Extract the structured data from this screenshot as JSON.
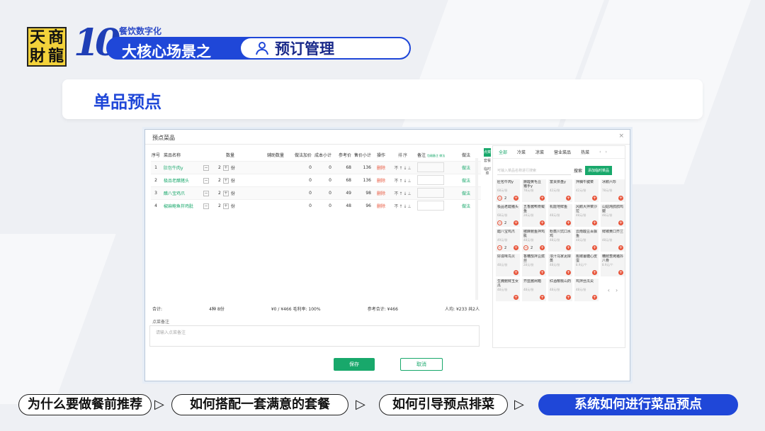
{
  "header": {
    "logo_chars": [
      "天",
      "商",
      "財",
      "龍"
    ],
    "ten": "10",
    "subtitle": "餐饮数字化",
    "banner_left": "大核心场景之",
    "banner_right": "预订管理"
  },
  "section_title": "单品预点",
  "dialog": {
    "title": "预点菜品",
    "close": "×",
    "columns": {
      "no": "序号",
      "name": "菜品名称",
      "qty": "数量",
      "aux": "辅助数量",
      "method_add": "做法加价",
      "cost": "成本小计",
      "ref": "参考价",
      "sale": "售价小计",
      "op": "操作",
      "sort": "排序",
      "note": "备注",
      "note_tags": "包厢备注 做法",
      "method": "做法"
    },
    "rows": [
      {
        "no": "1",
        "name": "肚包牛肉y",
        "qty": "2",
        "unit": "份",
        "method_add": "0",
        "cost": "0",
        "ref": "68",
        "sale": "136",
        "op": "删除",
        "method": "做法"
      },
      {
        "no": "2",
        "name": "极品老醋猪头",
        "qty": "2",
        "unit": "份",
        "method_add": "0",
        "cost": "0",
        "ref": "68",
        "sale": "136",
        "op": "删除",
        "method": "做法"
      },
      {
        "no": "3",
        "name": "醋八宝鸡爪",
        "qty": "2",
        "unit": "份",
        "method_add": "0",
        "cost": "0",
        "ref": "49",
        "sale": "98",
        "op": "删除",
        "method": "做法"
      },
      {
        "no": "4",
        "name": "椒麻鲍鱼拌鸡肶",
        "qty": "2",
        "unit": "份",
        "method_add": "0",
        "cost": "0",
        "ref": "48",
        "sale": "96",
        "op": "删除",
        "method": "做法"
      }
    ],
    "sort_icons": "不↑↓⊥",
    "totals": {
      "label": "合计:",
      "items": "4种 8份",
      "money": "¥0 / ¥466 毛利率: 100%",
      "ref_total": "参考合计: ¥466",
      "per_person": "人均: ¥233 共2人"
    },
    "remark_label": "点菜备注",
    "remark_placeholder": "请输入点菜备注",
    "save": "保存",
    "cancel": "取消"
  },
  "panel": {
    "vtabs": [
      "点菜",
      "套餐",
      "临时菜"
    ],
    "categories": [
      "全部",
      "冷菜",
      "凉菜",
      "营业菜品",
      "热菜"
    ],
    "search_placeholder": "可输入菜品名称进行搜索",
    "search_btn": "搜索",
    "add_btn": "添加临时菜品",
    "items": [
      {
        "name": "肚包牛肉y",
        "price": "68元/份",
        "count": "2"
      },
      {
        "name": "麻酸黄毛豆 猪手y",
        "price": "78元/份"
      },
      {
        "name": "富贵拼盘y",
        "price": "42元/份"
      },
      {
        "name": "拌胸牛腱菜",
        "price": "42元/份"
      },
      {
        "name": "冰鹅六珍",
        "price": "78元/份"
      },
      {
        "name": "极品老醋猪头",
        "price": "68元/份",
        "count": "2"
      },
      {
        "name": "五香酱鸭脊鲅鱼",
        "price": "28元/份"
      },
      {
        "name": "机能地鲜鱼",
        "price": "48元/份"
      },
      {
        "name": "风鹅大拌菜沙拉",
        "price": "48元/份"
      },
      {
        "name": "山姑炖鸽鸽鸡腿",
        "price": "48元/份"
      },
      {
        "name": "醋八宝鸡爪",
        "price": "49元/份",
        "count": "2"
      },
      {
        "name": "椒麻鲍鱼拌鸡肶",
        "price": "48元/份",
        "count": "2"
      },
      {
        "name": "粉蒸川式口水鸡",
        "price": "48元/份"
      },
      {
        "name": "云南酸豆百飘鱼",
        "price": "48元/份"
      },
      {
        "name": "鲜椒黄口芥兰",
        "price": "48元/份"
      },
      {
        "name": "好滋味鸟贝",
        "price": "48元/份"
      },
      {
        "name": "香糟茄拌豆腐丝",
        "price": "28元/份"
      },
      {
        "name": "浓汁马家泥岸蒸",
        "price": "48元/份"
      },
      {
        "name": "桃椒薯糖心皮蛋",
        "price": "8.9元/个"
      },
      {
        "name": "糟鲜葱烤猪抖八骨",
        "price": "8.9元/个"
      },
      {
        "name": "生腌鲍鲜玉女瓜",
        "price": "48元/份"
      },
      {
        "name": "芥蓝酱闸箱",
        "price": "48元/份"
      },
      {
        "name": "红酒樱桃山药",
        "price": "48元/份"
      },
      {
        "name": "鸡拌丝瓜尖",
        "price": "48元/份"
      }
    ],
    "pager_prev": "‹",
    "pager_next": "›"
  },
  "bottom_nav": [
    "为什么要做餐前推荐",
    "如何搭配一套满意的套餐",
    "如何引导预点排菜",
    "系统如何进行菜品预点"
  ],
  "arrow": "▷"
}
